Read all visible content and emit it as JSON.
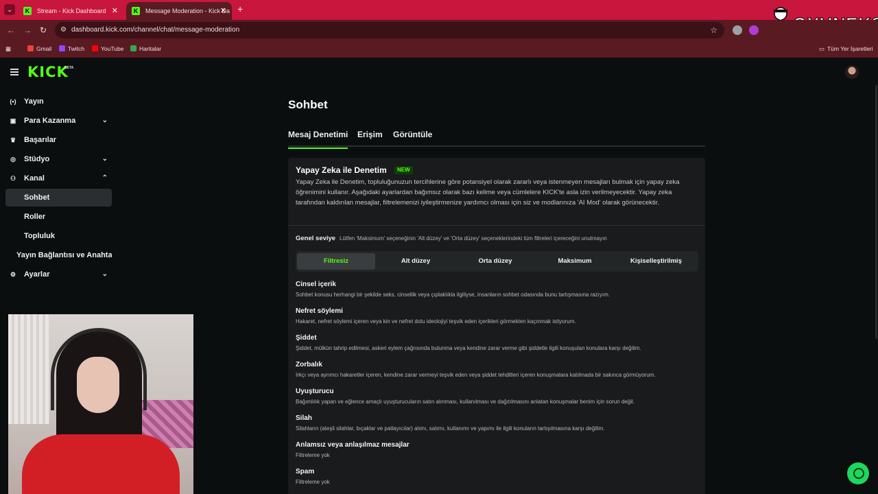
{
  "browser": {
    "tabs": [
      {
        "title": "Stream - Kick Dashboard",
        "favicon": "K"
      },
      {
        "title": "Message Moderation - Kick Da",
        "favicon": "K"
      }
    ],
    "url": "dashboard.kick.com/channel/chat/message-moderation",
    "bookmarks": [
      {
        "label": "Gmail",
        "color": "#ea4335"
      },
      {
        "label": "Twitch",
        "color": "#9146ff"
      },
      {
        "label": "YouTube",
        "color": "#ff0000"
      },
      {
        "label": "Haritalar",
        "color": "#34a853"
      }
    ],
    "all_bookmarks": "Tüm Yer İşaretleri",
    "watermark": "OYUNEKS"
  },
  "app": {
    "logo": "KICK",
    "logo_badge": "BETA",
    "sidebar": [
      {
        "label": "Yayın",
        "icon": "broadcast-icon",
        "chevron": ""
      },
      {
        "label": "Para Kazanma",
        "icon": "wallet-icon",
        "chevron": "⌄"
      },
      {
        "label": "Başarılar",
        "icon": "trophy-icon",
        "chevron": ""
      },
      {
        "label": "Stüdyo",
        "icon": "studio-icon",
        "chevron": "⌄"
      },
      {
        "label": "Kanal",
        "icon": "channel-icon",
        "chevron": "⌃"
      },
      {
        "label": "Sohbet",
        "icon": "",
        "chevron": ""
      },
      {
        "label": "Roller",
        "icon": "",
        "chevron": ""
      },
      {
        "label": "Topluluk",
        "icon": "",
        "chevron": ""
      },
      {
        "label": "Yayın Bağlantısı ve Anahtarı",
        "icon": "",
        "chevron": ""
      },
      {
        "label": "Ayarlar",
        "icon": "gear-icon",
        "chevron": "⌄"
      }
    ],
    "page_title": "Sohbet",
    "tabs": [
      "Mesaj Denetimi",
      "Erişim",
      "Görüntüle"
    ],
    "ai_card": {
      "title": "Yapay Zeka ile Denetim",
      "badge": "NEW",
      "description": "Yapay Zeka ile Denetim, topluluğunuzun tercihlerine göre potansiyel olarak zararlı veya istenmeyen mesajları bulmak için yapay zeka öğrenimini kullanır. Aşağıdaki ayarlardan bağımsız olarak bazı kelime veya cümlelere KICK'te asla izin verilmeyecektir. Yapay zeka tarafından kaldırılan mesajlar, filtrelemenizi iyileştirmenize yardımcı olması için siz ve modlarınıza 'AI Mod' olarak görünecektir.",
      "level_label": "Genel seviye",
      "level_note": "Lütfen 'Maksimum' seçeneğinin 'Alt düzey' ve 'Orta düzey' seçeneklerindeki tüm filtreleri içereceğini unutmayın",
      "levels": [
        "Filtresiz",
        "Alt düzey",
        "Orta düzey",
        "Maksimum",
        "Kişiselleştirilmiş"
      ],
      "selected_level": "Filtresiz",
      "categories": [
        {
          "title": "Cinsel içerik",
          "desc": "Sohbet konusu herhangi bir şekilde seks, cinsellik veya çıplaklıkla ilgiliyse, insanların sohbet odasında bunu tartışmasına razıyım."
        },
        {
          "title": "Nefret söylemi",
          "desc": "Hakaret, nefret söylemi içeren veya kin ve nefret dolu ideolojiyi teşvik eden içerikleri görmekten kaçınmak istiyorum."
        },
        {
          "title": "Şiddet",
          "desc": "Şiddet, mülkün tahrip edilmesi, askeri eylem çağrısında bulunma veya kendine zarar verme gibi şiddetle ilgili konuşulan konulara karşı değilim."
        },
        {
          "title": "Zorbalık",
          "desc": "Irkçı veya ayrımcı hakaretler içeren, kendine zarar vermeyi teşvik eden veya şiddet tehditleri içeren konuşmalara katılmada bir sakınca görmüyorum."
        },
        {
          "title": "Uyuşturucu",
          "desc": "Bağımlılık yapan ve eğlence amaçlı uyuşturucuların satın alınması, kullanılması ve dağıtılmasını anlatan konuşmalar benim için sorun değil."
        },
        {
          "title": "Silah",
          "desc": "Silahların (ateşli silahlar, bıçaklar ve patlayıcılar) alımı, satımı, kullanımı ve yapımı ile ilgili konuların tartışılmasına karşı değilim."
        },
        {
          "title": "Anlamsız veya anlaşılmaz mesajlar",
          "desc": "Filtreleme yok"
        },
        {
          "title": "Spam",
          "desc": "Filtreleme yok"
        }
      ]
    },
    "accent_color": "#53fc18"
  }
}
